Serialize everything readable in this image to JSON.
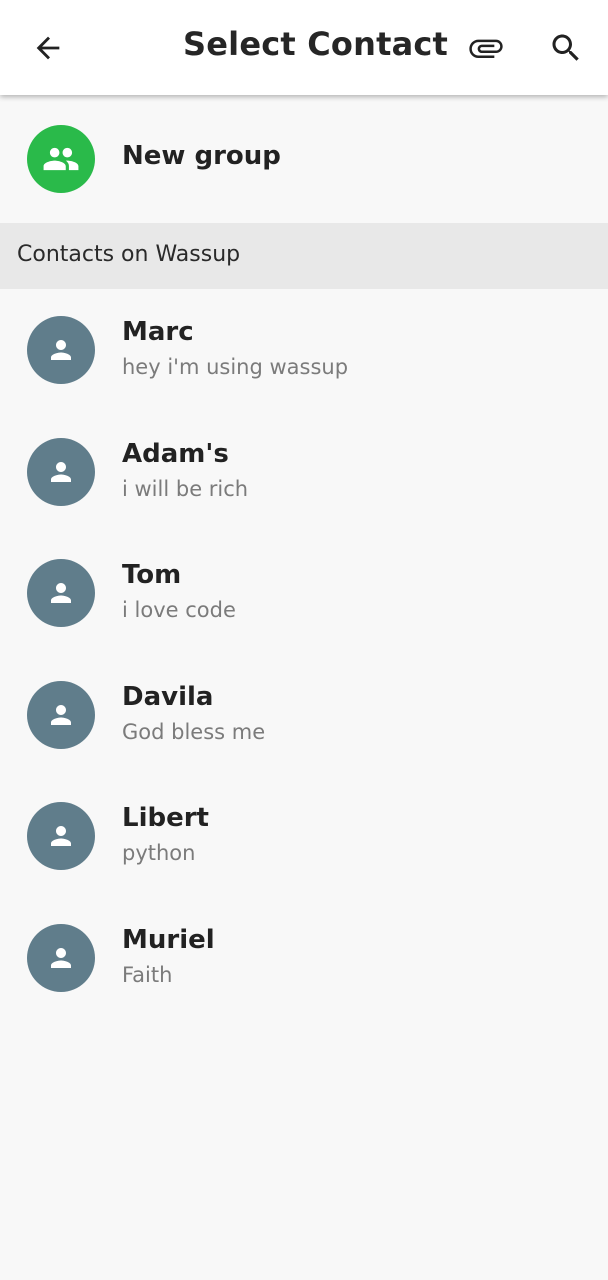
{
  "header": {
    "title": "Select Contact",
    "back_icon": "arrow-back-icon",
    "attach_icon": "paperclip-icon",
    "search_icon": "search-icon"
  },
  "new_group": {
    "label": "New group",
    "icon": "group-icon",
    "color": "#2aba4a"
  },
  "section": {
    "title": "Contacts on Wassup"
  },
  "contacts": [
    {
      "name": "Marc",
      "status": "hey i'm using wassup"
    },
    {
      "name": "Adam's",
      "status": "i will be rich"
    },
    {
      "name": "Tom",
      "status": "i love code"
    },
    {
      "name": "Davila",
      "status": "God bless me"
    },
    {
      "name": "Libert",
      "status": "python"
    },
    {
      "name": "Muriel",
      "status": "Faith"
    }
  ],
  "colors": {
    "avatar": "#607d8b",
    "background": "#f8f8f8",
    "section_bg": "#e8e8e8"
  }
}
